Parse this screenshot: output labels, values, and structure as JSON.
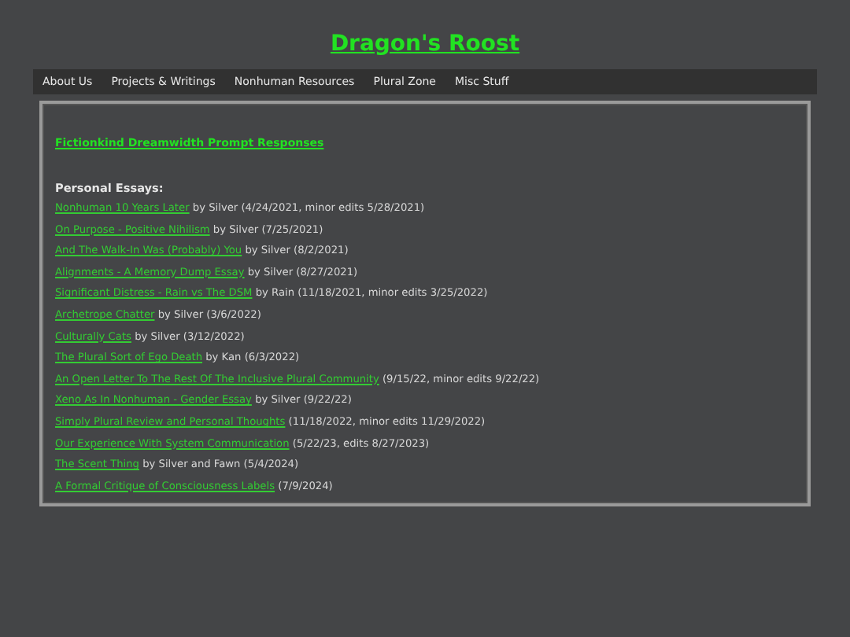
{
  "site_title": "Dragon's Roost",
  "nav": [
    "About Us",
    "Projects & Writings",
    "Nonhuman Resources",
    "Plural Zone",
    "Misc Stuff"
  ],
  "feature_link": "Fictionkind Dreamwidth Prompt Responses",
  "section_heading": "Personal Essays:",
  "essays": [
    {
      "link": "Nonhuman 10 Years Later",
      "note": "by Silver (4/24/2021, minor edits 5/28/2021)"
    },
    {
      "link": "On Purpose - Positive Nihilism",
      "note": "by Silver (7/25/2021)"
    },
    {
      "link": "And The Walk-In Was (Probably) You",
      "note": "by Silver (8/2/2021)"
    },
    {
      "link": "Alignments - A Memory Dump Essay",
      "note": "by Silver (8/27/2021)"
    },
    {
      "link": "Significant Distress - Rain vs The DSM",
      "note": "by Rain (11/18/2021, minor edits 3/25/2022)"
    },
    {
      "link": "Archetrope Chatter",
      "note": "by Silver (3/6/2022)"
    },
    {
      "link": "Culturally Cats",
      "note": "by Silver (3/12/2022)"
    },
    {
      "link": "The Plural Sort of Ego Death",
      "note": "by Kan (6/3/2022)"
    },
    {
      "link": "An Open Letter To The Rest Of The Inclusive Plural Community",
      "note": "(9/15/22, minor edits 9/22/22)"
    },
    {
      "link": "Xeno As In Nonhuman - Gender Essay",
      "note": "by Silver (9/22/22)"
    },
    {
      "link": "Simply Plural Review and Personal Thoughts",
      "note": "(11/18/2022, minor edits 11/29/2022)"
    },
    {
      "link": "Our Experience With System Communication",
      "note": "(5/22/23, edits 8/27/2023)"
    },
    {
      "link": "The Scent Thing",
      "note": "by Silver and Fawn (5/4/2024)"
    },
    {
      "link": "A Formal Critique of Consciousness Labels",
      "note": "(7/9/2024)"
    }
  ]
}
